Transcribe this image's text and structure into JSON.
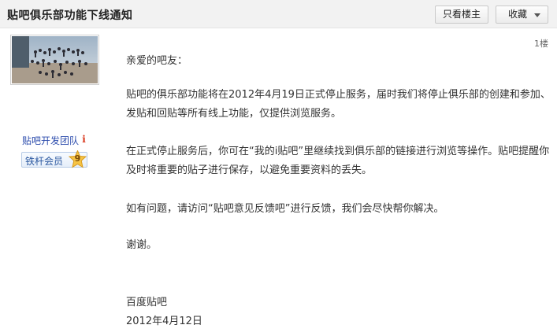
{
  "header": {
    "title": "贴吧俱乐部功能下线通知",
    "only_op_label": "只看楼主",
    "favorite_label": "收藏"
  },
  "sidebar": {
    "author": "贴吧开发团队",
    "badge_label": "铁杆会员",
    "badge_level": "9",
    "info_icon": "info-icon"
  },
  "post": {
    "floor": "1楼",
    "greeting": "亲爱的吧友：",
    "para1": "贴吧的俱乐部功能将在2012年4月19日正式停止服务，届时我们将停止俱乐部的创建和参加、发贴和回贴等所有线上功能，仅提供浏览服务。",
    "para2": "在正式停止服务后，你可在“我的i贴吧”里继续找到俱乐部的链接进行浏览等操作。贴吧提醒你及时将重要的贴子进行保存，以避免重要资料的丢失。",
    "para3": "如有问题，请访问“贴吧意见反馈吧”进行反馈，我们会尽快帮你解决。",
    "thanks": "谢谢。",
    "signature": "百度贴吧",
    "date": "2012年4月12日"
  }
}
